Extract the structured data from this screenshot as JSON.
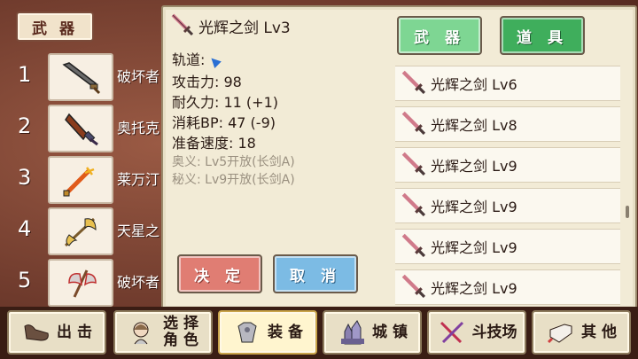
{
  "left_panel": {
    "category_tab": "武 器",
    "slots": [
      {
        "number": "1",
        "name": "破坏者",
        "icon": "cleaver-icon"
      },
      {
        "number": "2",
        "name": "奥托克",
        "icon": "bell-sword-icon"
      },
      {
        "number": "3",
        "name": "莱万汀",
        "icon": "flame-sword-icon"
      },
      {
        "number": "4",
        "name": "天星之",
        "icon": "halberd-icon"
      },
      {
        "number": "5",
        "name": "破坏者",
        "icon": "axe-icon"
      }
    ]
  },
  "detail": {
    "title": "光辉之剑 Lv3",
    "stats": {
      "orbit_label": "轨道:",
      "attack": "攻击力: 98",
      "durability": "耐久力: 11 (+1)",
      "bp_cost": "消耗BP: 47 (-9)",
      "ready_speed": "准备速度: 18",
      "secret1": "奥义:  Lv5开放(长剑A)",
      "secret2": "秘义:  Lv9开放(长剑A)"
    },
    "confirm_label": "决 定",
    "cancel_label": "取 消"
  },
  "inventory": {
    "tab_weapons": "武 器",
    "tab_items": "道 具",
    "items": [
      {
        "name": "光辉之剑 Lv6"
      },
      {
        "name": "光辉之剑 Lv8"
      },
      {
        "name": "光辉之剑 Lv9"
      },
      {
        "name": "光辉之剑 Lv9"
      },
      {
        "name": "光辉之剑 Lv9"
      },
      {
        "name": "光辉之剑 Lv9"
      }
    ]
  },
  "nav": {
    "sortie": "出 击",
    "select_char_1": "选 择",
    "select_char_2": "角 色",
    "equip": "装 备",
    "town": "城 镇",
    "arena": "斗技场",
    "other": "其 他"
  },
  "colors": {
    "confirm": "#e07d73",
    "cancel": "#7cbbe4",
    "tab_active": "#7ed693",
    "tab_inactive": "#3fae5c"
  }
}
